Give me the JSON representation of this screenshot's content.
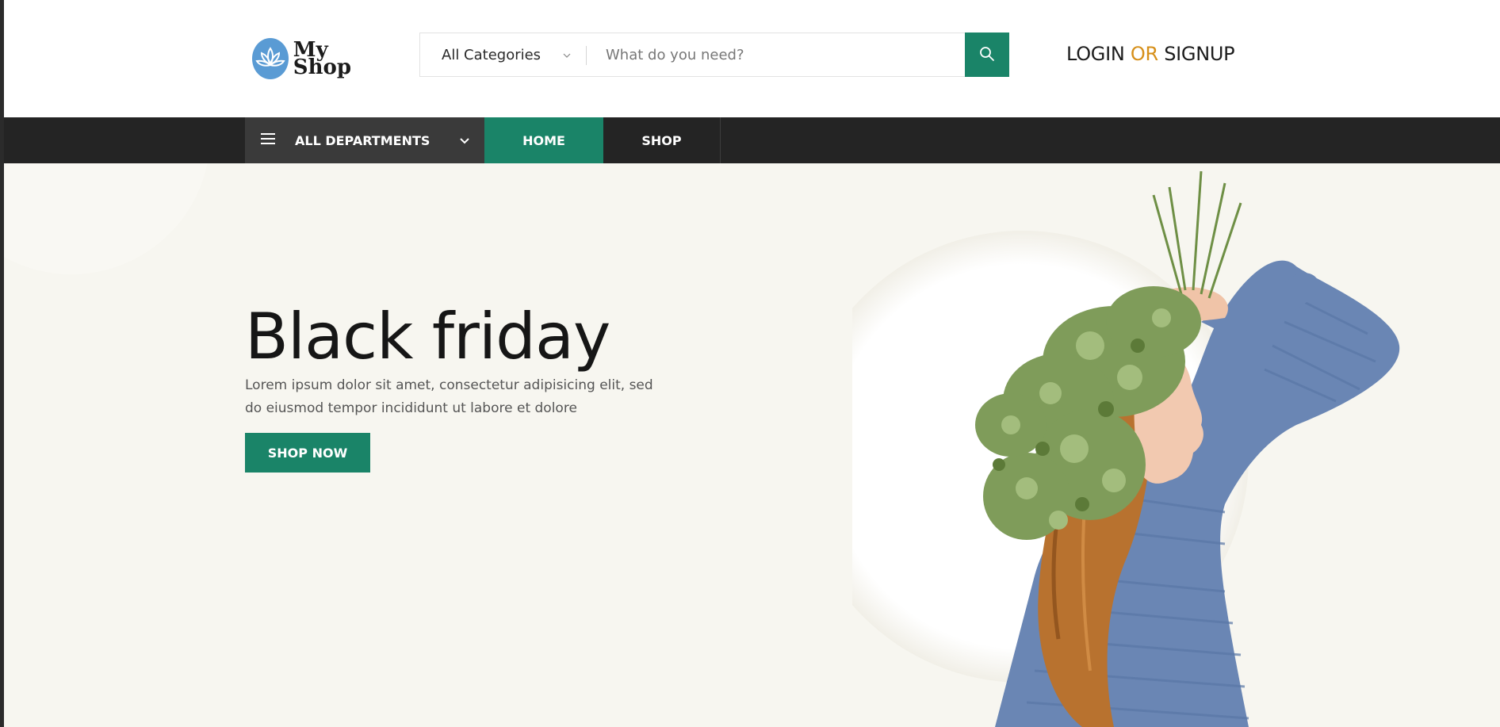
{
  "header": {
    "logo": {
      "line1": "My",
      "line2": "Shop"
    },
    "search": {
      "category": "All Categories",
      "placeholder": "What do you need?"
    },
    "auth": {
      "login": "LOGIN",
      "or": "OR",
      "signup": "SIGNUP"
    }
  },
  "nav": {
    "departments": "ALL DEPARTMENTS",
    "items": [
      {
        "label": "HOME",
        "active": true
      },
      {
        "label": "SHOP",
        "active": false
      }
    ]
  },
  "hero": {
    "title": "Black friday",
    "text": "Lorem ipsum dolor sit amet, consectetur adipisicing elit, sed do eiusmod tempor incididunt ut labore et dolore",
    "button": "SHOP NOW"
  },
  "colors": {
    "accent": "#1a8468",
    "or_highlight": "#d68f19",
    "navbar": "#242424",
    "hero_bg": "#f7f6f0",
    "logo": "#5a9bd4"
  },
  "icons": [
    "lotus-logo-icon",
    "chevron-down-icon",
    "search-icon",
    "hamburger-icon"
  ]
}
